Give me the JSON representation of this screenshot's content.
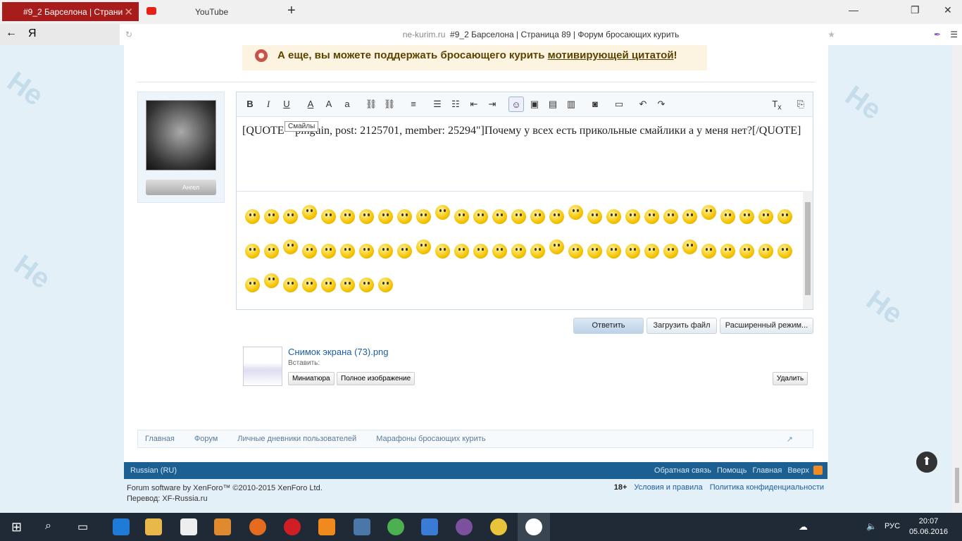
{
  "browser": {
    "tabs": [
      {
        "label": "#9_2 Барселона | Страни"
      },
      {
        "label": "YouTube"
      }
    ],
    "url_domain": "ne-kurim.ru",
    "url_title": "#9_2 Барселона | Страница 89 | Форум бросающих курить",
    "logo": "Я"
  },
  "notice": {
    "text": "А еще, вы можете поддержать бросающего курить ",
    "link": "мотивирующей цитатой",
    "end": "!"
  },
  "user": {
    "rank": "Ангел"
  },
  "editor": {
    "tooltip": "Смайлы",
    "content": "[QUOTE=\"pinguin, post: 2125701, member: 25294\"]Почему у всех есть прикольные смайлики а у меня нет?[/QUOTE]"
  },
  "buttons": {
    "reply": "Ответить",
    "upload": "Загрузить файл",
    "advanced": "Расширенный режим..."
  },
  "attachment": {
    "name": "Снимок экрана (73).png",
    "insert_label": "Вставить:",
    "thumb": "Миниатюра",
    "full": "Полное изображение",
    "delete": "Удалить"
  },
  "breadcrumbs": [
    "Главная",
    "Форум",
    "Личные дневники пользователей",
    "Марафоны бросающих курить"
  ],
  "footer": {
    "language": "Russian (RU)",
    "links": [
      "Обратная связь",
      "Помощь",
      "Главная",
      "Вверх"
    ],
    "copyright": "Forum software by XenForo™ ©2010-2015 XenForo Ltd.",
    "translation": "Перевод: XF-Russia.ru",
    "age": "18+",
    "terms": "Условия и правила",
    "privacy": "Политика конфиденциальности"
  },
  "taskbar": {
    "lang": "РУС",
    "time": "20:07",
    "date": "05.06.2016"
  }
}
